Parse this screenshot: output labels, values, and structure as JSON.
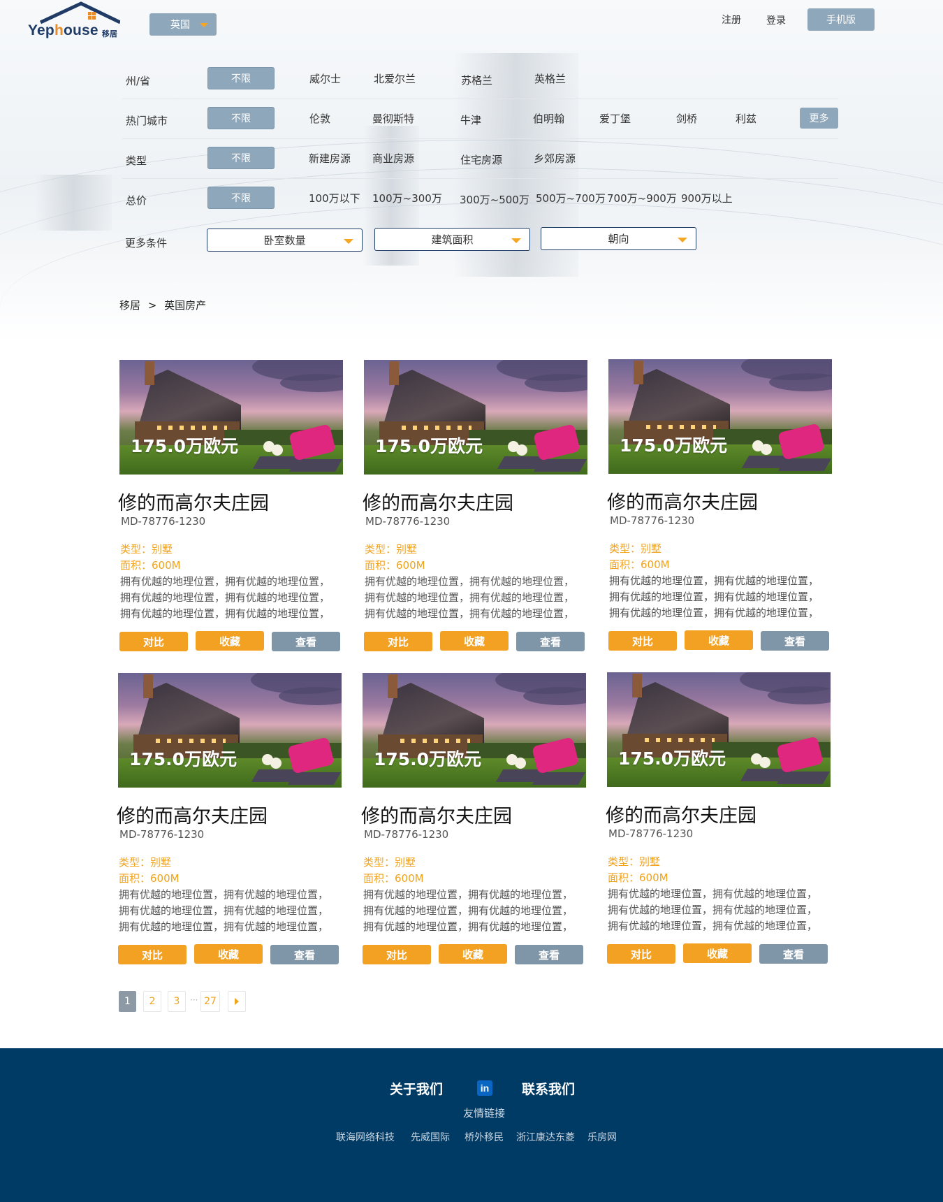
{
  "header": {
    "logo_text_a": "Yep",
    "logo_text_b": "h",
    "logo_text_c": "ouse",
    "logo_cn": "移居",
    "country": "英国",
    "register": "注册",
    "login": "登录",
    "mobile": "手机版"
  },
  "filters": {
    "unlimited": "不限",
    "more": "更多",
    "rows": [
      {
        "label": "州/省",
        "options": [
          "威尔士",
          "北爱尔兰",
          "苏格兰",
          "英格兰"
        ]
      },
      {
        "label": "热门城市",
        "options": [
          "伦敦",
          "曼彻斯特",
          "牛津",
          "伯明翰",
          "爱丁堡",
          "剑桥",
          "利兹"
        ]
      },
      {
        "label": "类型",
        "options": [
          "新建房源",
          "商业房源",
          "住宅房源",
          "乡郊房源"
        ]
      },
      {
        "label": "总价",
        "options": [
          "100万以下",
          "100万~300万",
          "300万~500万",
          "500万~700万",
          "700万~900万",
          "900万以上"
        ]
      }
    ],
    "more_label": "更多条件",
    "selects": [
      "卧室数量",
      "建筑面积",
      "朝向"
    ]
  },
  "breadcrumb": {
    "home": "移居",
    "sep": ">",
    "current": "英国房产"
  },
  "listings": [
    {
      "price": "175.0万欧元",
      "title": "修的而高尔夫庄园",
      "code": "MD-78776-1230",
      "type": "类型：别墅",
      "area": "面积：600M",
      "desc": [
        "拥有优越的地理位置，拥有优越的地理位置，",
        "拥有优越的地理位置，拥有优越的地理位置，",
        "拥有优越的地理位置，拥有优越的地理位置，"
      ],
      "compare": "对比",
      "fav": "收藏",
      "view": "查看"
    },
    {
      "price": "175.0万欧元",
      "title": "修的而高尔夫庄园",
      "code": "MD-78776-1230",
      "type": "类型：别墅",
      "area": "面积：600M",
      "desc": [
        "拥有优越的地理位置，拥有优越的地理位置，",
        "拥有优越的地理位置，拥有优越的地理位置，",
        "拥有优越的地理位置，拥有优越的地理位置，"
      ],
      "compare": "对比",
      "fav": "收藏",
      "view": "查看"
    },
    {
      "price": "175.0万欧元",
      "title": "修的而高尔夫庄园",
      "code": "MD-78776-1230",
      "type": "类型：别墅",
      "area": "面积：600M",
      "desc": [
        "拥有优越的地理位置，拥有优越的地理位置，",
        "拥有优越的地理位置，拥有优越的地理位置，",
        "拥有优越的地理位置，拥有优越的地理位置，"
      ],
      "compare": "对比",
      "fav": "收藏",
      "view": "查看"
    },
    {
      "price": "175.0万欧元",
      "title": "修的而高尔夫庄园",
      "code": "MD-78776-1230",
      "type": "类型：别墅",
      "area": "面积：600M",
      "desc": [
        "拥有优越的地理位置，拥有优越的地理位置，",
        "拥有优越的地理位置，拥有优越的地理位置，",
        "拥有优越的地理位置，拥有优越的地理位置，"
      ],
      "compare": "对比",
      "fav": "收藏",
      "view": "查看"
    },
    {
      "price": "175.0万欧元",
      "title": "修的而高尔夫庄园",
      "code": "MD-78776-1230",
      "type": "类型：别墅",
      "area": "面积：600M",
      "desc": [
        "拥有优越的地理位置，拥有优越的地理位置，",
        "拥有优越的地理位置，拥有优越的地理位置，",
        "拥有优越的地理位置，拥有优越的地理位置，"
      ],
      "compare": "对比",
      "fav": "收藏",
      "view": "查看"
    },
    {
      "price": "175.0万欧元",
      "title": "修的而高尔夫庄园",
      "code": "MD-78776-1230",
      "type": "类型：别墅",
      "area": "面积：600M",
      "desc": [
        "拥有优越的地理位置，拥有优越的地理位置，",
        "拥有优越的地理位置，拥有优越的地理位置，",
        "拥有优越的地理位置，拥有优越的地理位置，"
      ],
      "compare": "对比",
      "fav": "收藏",
      "view": "查看"
    }
  ],
  "pagination": {
    "pages": [
      "1",
      "2",
      "3",
      "27"
    ],
    "ellipsis": "···",
    "current": "1",
    "next_icon": "caret-right-icon"
  },
  "footer": {
    "about": "关于我们",
    "linkedin": "in",
    "contact": "联系我们",
    "friends": "友情链接",
    "partners": [
      "联海网络科技",
      "先威国际",
      "桥外移民",
      "浙江康达东菱",
      "乐房网"
    ]
  },
  "colors": {
    "accent": "#f2a122",
    "steel": "#8ea7bb",
    "navy": "#003b66",
    "gray_button": "#7f95a8"
  }
}
